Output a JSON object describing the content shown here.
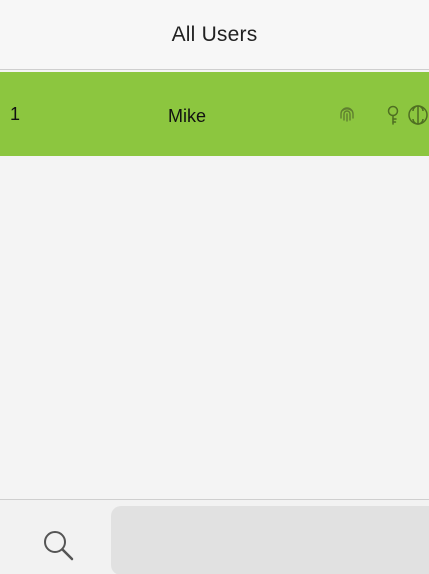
{
  "header": {
    "title": "All Users"
  },
  "users": [
    {
      "id": "1",
      "name": "Mike",
      "icons": [
        "fingerprint-icon",
        "key-icon",
        "face-icon"
      ]
    }
  ],
  "colors": {
    "selected_row": "#8cc63f",
    "background": "#f4f4f4",
    "search_field": "#e1e1e1"
  },
  "search": {
    "icon": "search-icon",
    "value": "",
    "placeholder": ""
  }
}
